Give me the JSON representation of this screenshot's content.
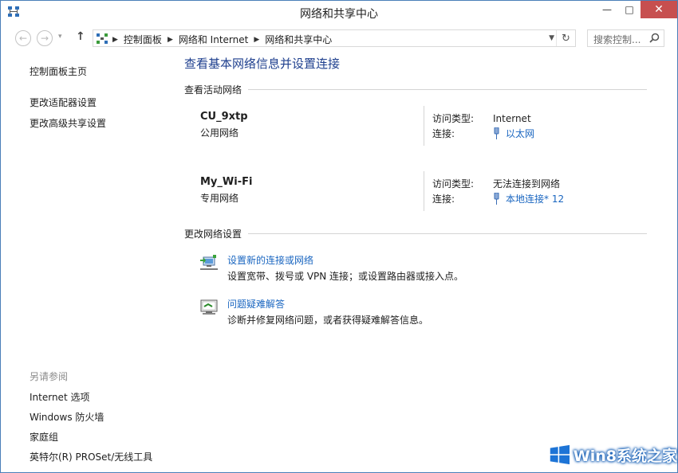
{
  "window": {
    "title": "网络和共享中心",
    "minimize": "—",
    "maximize": "□",
    "close": "✕"
  },
  "nav": {
    "back": "←",
    "forward": "→",
    "dropdown": "▾",
    "up": "↑",
    "breadcrumbs": [
      "控制面板",
      "网络和 Internet",
      "网络和共享中心"
    ],
    "search_placeholder": "搜索控制..."
  },
  "sidebar": {
    "home": "控制面板主页",
    "links": [
      "更改适配器设置",
      "更改高级共享设置"
    ],
    "see_also_title": "另请参阅",
    "see_also": [
      "Internet 选项",
      "Windows 防火墙",
      "家庭组",
      "英特尔(R) PROSet/无线工具"
    ]
  },
  "main": {
    "page_title": "查看基本网络信息并设置连接",
    "active_section": "查看活动网络",
    "networks": [
      {
        "name": "CU_9xtp",
        "type": "公用网络",
        "access_label": "访问类型:",
        "access_value": "Internet",
        "conn_label": "连接:",
        "conn_value": "以太网"
      },
      {
        "name": "My_Wi-Fi",
        "type": "专用网络",
        "access_label": "访问类型:",
        "access_value": "无法连接到网络",
        "conn_label": "连接:",
        "conn_value": "本地连接* 12"
      }
    ],
    "change_section": "更改网络设置",
    "tasks": [
      {
        "title": "设置新的连接或网络",
        "desc": "设置宽带、拨号或 VPN 连接；或设置路由器或接入点。",
        "icon": "network-setup-icon"
      },
      {
        "title": "问题疑难解答",
        "desc": "诊断并修复网络问题，或者获得疑难解答信息。",
        "icon": "troubleshoot-icon"
      }
    ]
  },
  "watermark": {
    "text": "Win8系统之家"
  },
  "colors": {
    "link": "#1a66c0",
    "title": "#1e3f8e",
    "close": "#c74f4f"
  }
}
